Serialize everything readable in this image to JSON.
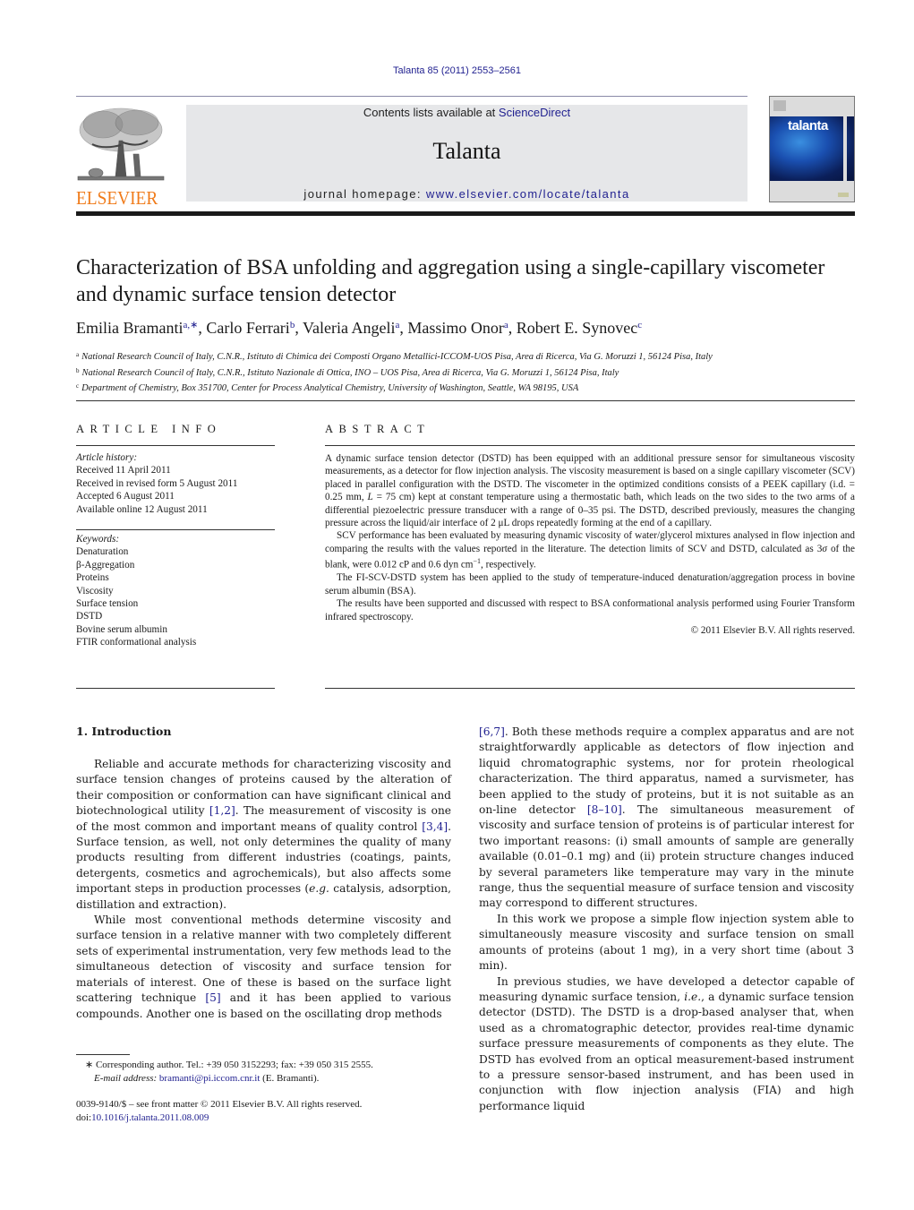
{
  "header": {
    "citation": "Talanta 85 (2011) 2553–2561",
    "contents_prefix": "Contents lists available at ",
    "contents_link": "ScienceDirect",
    "journal_name": "Talanta",
    "homepage_prefix": "journal homepage: ",
    "homepage_link": "www.elsevier.com/locate/talanta",
    "publisher_wordmark": "ELSEVIER",
    "cover_title": "talanta",
    "colors": {
      "link": "#1f1f8f",
      "publisher_orange": "#f07b1a",
      "banner_bg": "#e6e7e9"
    }
  },
  "article": {
    "title": "Characterization of BSA unfolding and aggregation using a single-capillary viscometer and dynamic surface tension detector",
    "authors": [
      {
        "name": "Emilia Bramanti",
        "sup": "a,∗",
        "sep": ", "
      },
      {
        "name": "Carlo Ferrari",
        "sup": "b",
        "sep": ", "
      },
      {
        "name": "Valeria Angeli",
        "sup": "a",
        "sep": ", "
      },
      {
        "name": "Massimo Onor",
        "sup": "a",
        "sep": ", "
      },
      {
        "name": "Robert E. Synovec",
        "sup": "c",
        "sep": ""
      }
    ],
    "affiliations": [
      {
        "key": "a",
        "text": "National Research Council of Italy, C.N.R., Istituto di Chimica dei Composti Organo Metallici-ICCOM-UOS Pisa, Area di Ricerca, Via G. Moruzzi 1, 56124 Pisa, Italy"
      },
      {
        "key": "b",
        "text": "National Research Council of Italy, C.N.R., Istituto Nazionale di Ottica, INO – UOS Pisa, Area di Ricerca, Via G. Moruzzi 1, 56124 Pisa, Italy"
      },
      {
        "key": "c",
        "text": "Department of Chemistry, Box 351700, Center for Process Analytical Chemistry, University of Washington, Seattle, WA 98195, USA"
      }
    ]
  },
  "article_info": {
    "heading": "ARTICLE INFO",
    "history_label": "Article history:",
    "history": [
      "Received 11 April 2011",
      "Received in revised form 5 August 2011",
      "Accepted 6 August 2011",
      "Available online 12 August 2011"
    ],
    "keywords_label": "Keywords:",
    "keywords": [
      "Denaturation",
      "β-Aggregation",
      "Proteins",
      "Viscosity",
      "Surface tension",
      "DSTD",
      "Bovine serum albumin",
      "FTIR conformational analysis"
    ]
  },
  "abstract": {
    "heading": "ABSTRACT",
    "p1_a": "A dynamic surface tension detector (DSTD) has been equipped with an additional pressure sensor for simultaneous viscosity measurements, as a detector for flow injection analysis. The viscosity measurement is based on a single capillary viscometer (SCV) placed in parallel configuration with the DSTD. The viscometer in the optimized conditions consists of a PEEK capillary (i.d. = 0.25 mm, ",
    "p1_L": "L",
    "p1_b": " = 75 cm) kept at constant temperature using a thermostatic bath, which leads on the two sides to the two arms of a differential piezoelectric pressure transducer with a range of 0–35 psi. The DSTD, described previously, measures the changing pressure across the liquid/air interface of 2 μL drops repeatedly forming at the end of a capillary.",
    "p2_a": "SCV performance has been evaluated by measuring dynamic viscosity of water/glycerol mixtures analysed in flow injection and comparing the results with the values reported in the literature. The detection limits of SCV and DSTD, calculated as 3",
    "p2_sigma": "σ",
    "p2_b": " of the blank, were 0.012 cP and 0.6 dyn cm",
    "p2_exp": "−1",
    "p2_c": ", respectively.",
    "p3": "The FI-SCV-DSTD system has been applied to the study of temperature-induced denaturation/aggregation process in bovine serum albumin (BSA).",
    "p4": "The results have been supported and discussed with respect to BSA conformational analysis performed using Fourier Transform infrared spectroscopy.",
    "copyright": "© 2011 Elsevier B.V. All rights reserved."
  },
  "body": {
    "section_heading": "1.  Introduction",
    "left": {
      "p1_a": "Reliable and accurate methods for characterizing viscosity and surface tension changes of proteins caused by the alteration of their composition or conformation can have significant clinical and biotechnological utility ",
      "p1_ref1": "[1,2]",
      "p1_b": ". The measurement of viscosity is one of the most common and important means of quality control ",
      "p1_ref2": "[3,4]",
      "p1_c": ". Surface tension, as well, not only determines the quality of many products resulting from different industries (coatings, paints, detergents, cosmetics and agrochemicals), but also affects some important steps in production processes (",
      "p1_eg": "e.g.",
      "p1_d": " catalysis, adsorption, distillation and extraction).",
      "p2_a": "While most conventional methods determine viscosity and surface tension in a relative manner with two completely different sets of experimental instrumentation, very few methods lead to the simultaneous detection of viscosity and surface tension for materials of interest. One of these is based on the surface light scattering technique ",
      "p2_ref": "[5]",
      "p2_b": " and it has been applied to various compounds. Another one is based on the oscillating drop methods"
    },
    "right": {
      "p1_ref1": "[6,7]",
      "p1_a": ". Both these methods require a complex apparatus and are not straightforwardly applicable as detectors of flow injection and liquid chromatographic systems, nor for protein rheological characterization. The third apparatus, named a survismeter, has been applied to the study of proteins, but it is not suitable as an on-line detector ",
      "p1_ref2": "[8–10]",
      "p1_b": ". The simultaneous measurement of viscosity and surface tension of proteins is of particular interest for two important reasons: (i) small amounts of sample are generally available (0.01–0.1 mg) and (ii) protein structure changes induced by several parameters like temperature may vary in the minute range, thus the sequential measure of surface tension and viscosity may correspond to different structures.",
      "p2": "In this work we propose a simple flow injection system able to simultaneously measure viscosity and surface tension on small amounts of proteins (about 1 mg), in a very short time (about 3 min).",
      "p3_a": "In previous studies, we have developed a detector capable of measuring dynamic surface tension, ",
      "p3_ie": "i.e.",
      "p3_b": ", a dynamic surface tension detector (DSTD). The DSTD is a drop-based analyser that, when used as a chromatographic detector, provides real-time dynamic surface pressure measurements of components as they elute. The DSTD has evolved from an optical measurement-based instrument to a pressure sensor-based instrument, and has been used in conjunction with flow injection analysis (FIA) and high performance liquid"
    }
  },
  "footnote": {
    "marker": "∗",
    "corresponding": " Corresponding author. Tel.: +39 050 3152293; fax: +39 050 315 2555.",
    "email_label": "E-mail address:",
    "email": "bramanti@pi.iccom.cnr.it",
    "email_suffix": " (E. Bramanti)."
  },
  "front_matter": {
    "issn_line": "0039-9140/$ – see front matter © 2011 Elsevier B.V. All rights reserved.",
    "doi_prefix": "doi:",
    "doi": "10.1016/j.talanta.2011.08.009"
  }
}
